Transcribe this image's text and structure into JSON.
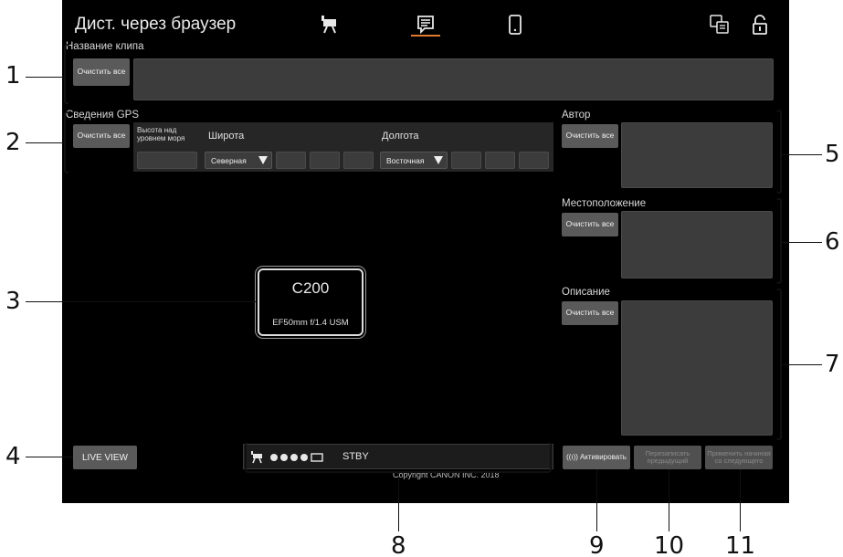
{
  "header": {
    "title": "Дист. через браузер",
    "tabs": [
      "camera-icon",
      "metadata-icon",
      "phone-icon"
    ],
    "right_icons": [
      "translate-icon",
      "lock-icon"
    ],
    "active_tab_color": "#e07a2e"
  },
  "clip_name": {
    "label": "Название клипа",
    "clear_label": "Очистить все",
    "value": ""
  },
  "gps": {
    "label": "Сведения GPS",
    "clear_label": "Очистить все",
    "altitude_label": "Высота над уровнем моря",
    "latitude_label": "Широта",
    "latitude_select": "Северная",
    "longitude_label": "Долгота",
    "longitude_select": "Восточная"
  },
  "author": {
    "label": "Автор",
    "clear_label": "Очистить все"
  },
  "location": {
    "label": "Местоположение",
    "clear_label": "Очистить все"
  },
  "description": {
    "label": "Описание",
    "clear_label": "Очистить все"
  },
  "camera_info": {
    "model": "C200",
    "lens": "EF50mm f/1.4 USM"
  },
  "live_view_label": "LIVE VIEW",
  "status": {
    "mode_icon": "camera-icon",
    "dots": 4,
    "state": "STBY"
  },
  "copyright": "Copyright CANON INC. 2018",
  "actions": {
    "activate_label": "Активировать",
    "overwrite_prev_label": "Перезаписать предыдущий",
    "apply_next_label": "Применить начиная со следующего"
  },
  "callouts": [
    "1",
    "2",
    "3",
    "4",
    "5",
    "6",
    "7",
    "8",
    "9",
    "10",
    "11"
  ]
}
